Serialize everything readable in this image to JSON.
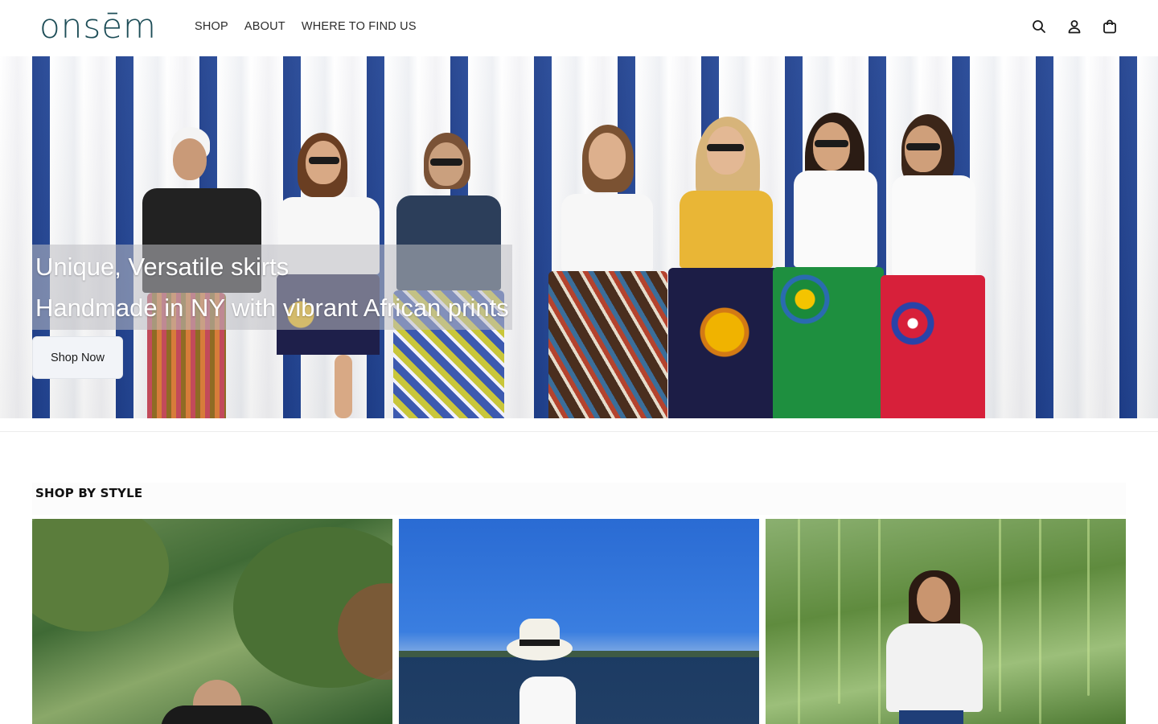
{
  "brand": {
    "logo_text": "onsem",
    "logo_color": "#1d4d57"
  },
  "nav": {
    "items": [
      "SHOP",
      "ABOUT",
      "WHERE TO FIND US"
    ]
  },
  "header_icons": [
    "search-icon",
    "account-icon",
    "cart-icon"
  ],
  "hero": {
    "line1": "Unique, Versatile skirts",
    "line2": "Handmade in NY with vibrant African prints",
    "cta_label": "Shop Now",
    "stripe_colors": [
      "#ffffff",
      "#1f3f8c"
    ]
  },
  "shop_by_style": {
    "title": "SHOP BY STYLE",
    "cards": [
      {
        "name": "style-card-1"
      },
      {
        "name": "style-card-2"
      },
      {
        "name": "style-card-3"
      }
    ]
  }
}
